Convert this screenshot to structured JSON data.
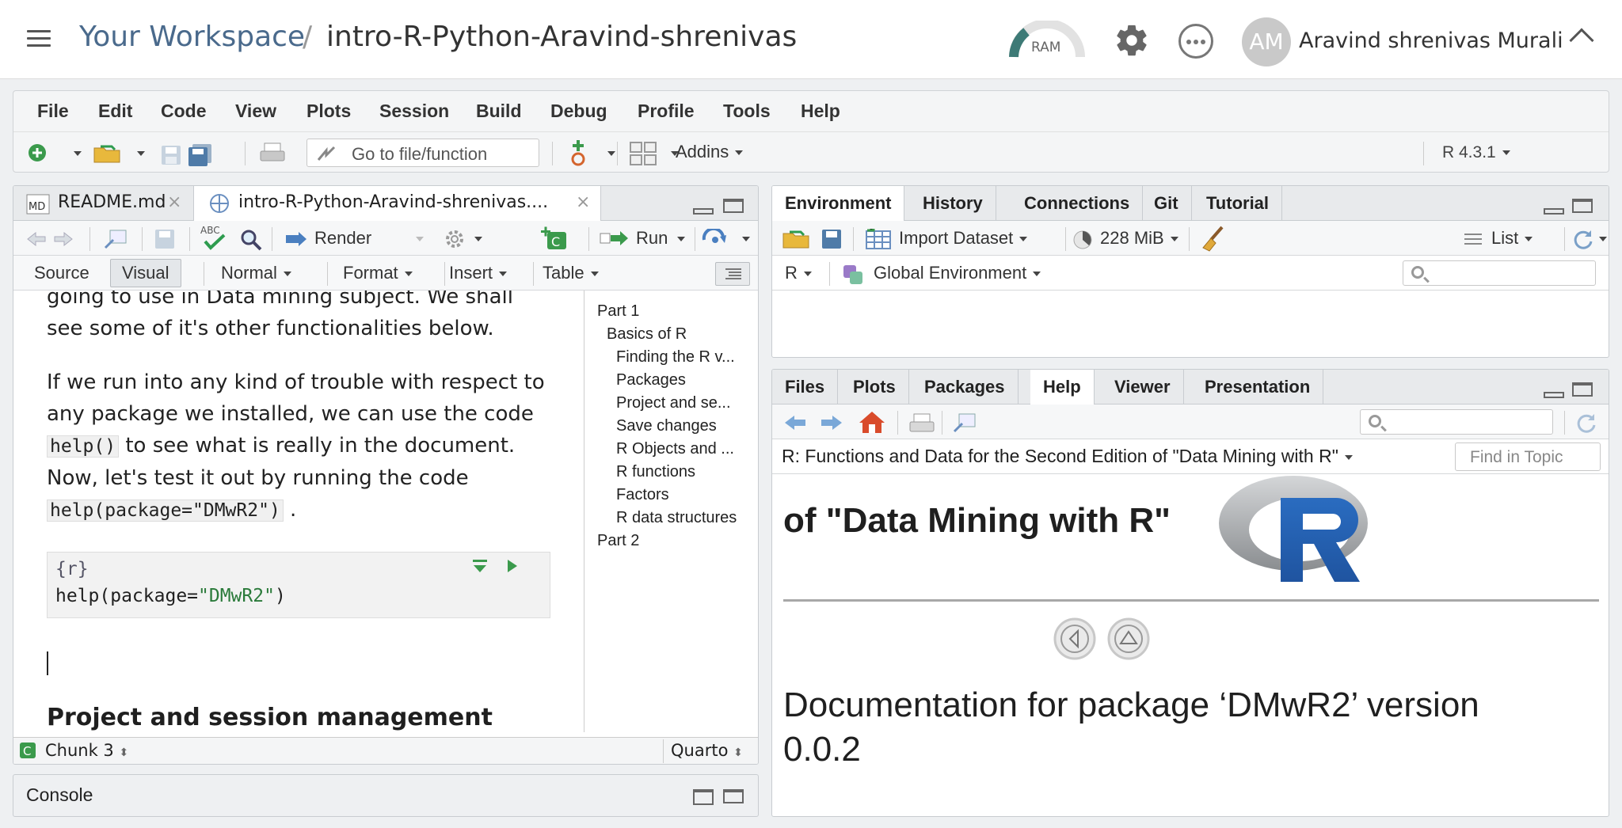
{
  "topbar": {
    "workspace_link": "Your Workspace",
    "separator": "/",
    "project_name": "intro-R-Python-Aravind-shrenivas",
    "ram_label": "RAM",
    "avatar_initials": "AM",
    "user_name": "Aravind shrenivas Murali"
  },
  "menu": [
    "File",
    "Edit",
    "Code",
    "View",
    "Plots",
    "Session",
    "Build",
    "Debug",
    "Profile",
    "Tools",
    "Help"
  ],
  "toolbar": {
    "goto_placeholder": "Go to file/function",
    "addins_label": "Addins",
    "r_version": "R 4.3.1"
  },
  "editor": {
    "tabs": [
      {
        "label": "README.md",
        "icon": "md-file-icon"
      },
      {
        "label": "intro-R-Python-Aravind-shrenivas....",
        "icon": "quarto-file-icon"
      }
    ],
    "toolbar": {
      "render": "Render",
      "run": "Run"
    },
    "format_bar": {
      "source": "Source",
      "visual": "Visual",
      "normal": "Normal",
      "format": "Format",
      "insert": "Insert",
      "table": "Table"
    },
    "content": {
      "p1_line1": "going to use in Data mining subject. We shall",
      "p1_line2": "see some of it's other functionalities below.",
      "p2_a": "If we run into any kind of trouble with respect to",
      "p2_b": "any package we installed, we can use the code",
      "p2_code1": "help()",
      "p2_c": " to see what is really in the document.",
      "p2_d": "Now, let's test it out by running the code",
      "p2_code2": "help(package=\"DMwR2\")",
      "p2_e": " .",
      "chunk_header": "{r}",
      "chunk_code_fn": "help(package=",
      "chunk_code_str": "\"DMwR2\"",
      "chunk_code_end": ")",
      "heading": "Project and session management"
    },
    "outline": [
      {
        "label": "Part 1",
        "level": 0
      },
      {
        "label": "Basics of R",
        "level": 1
      },
      {
        "label": "Finding the R v...",
        "level": 2
      },
      {
        "label": "Packages",
        "level": 2
      },
      {
        "label": "Project and se...",
        "level": 2
      },
      {
        "label": "Save changes",
        "level": 2
      },
      {
        "label": "R Objects and ...",
        "level": 2
      },
      {
        "label": "R functions",
        "level": 2
      },
      {
        "label": "Factors",
        "level": 2
      },
      {
        "label": "R data structures",
        "level": 2
      },
      {
        "label": "Part 2",
        "level": 0
      }
    ],
    "status": {
      "chunk": "Chunk 3",
      "mode": "Quarto"
    }
  },
  "console": {
    "label": "Console"
  },
  "env_pane": {
    "tabs": [
      "Environment",
      "History",
      "Connections",
      "Git",
      "Tutorial"
    ],
    "import_label": "Import Dataset",
    "memory": "228 MiB",
    "list_label": "List",
    "r_label": "R",
    "global_env": "Global Environment"
  },
  "files_pane": {
    "tabs": [
      "Files",
      "Plots",
      "Packages",
      "Help",
      "Viewer",
      "Presentation"
    ],
    "help_topic": "R: Functions and Data for the Second Edition of \"Data Mining with R\"",
    "find_placeholder": "Find in Topic",
    "banner_text": "of \"Data Mining with R\"",
    "doc_heading_1": "Documentation for package ‘DMwR2’ version",
    "doc_heading_2": "0.0.2"
  },
  "colors": {
    "accent_blue": "#3d6a9c",
    "r_logo_blue": "#2463b0",
    "run_green": "#2e9c4f"
  }
}
